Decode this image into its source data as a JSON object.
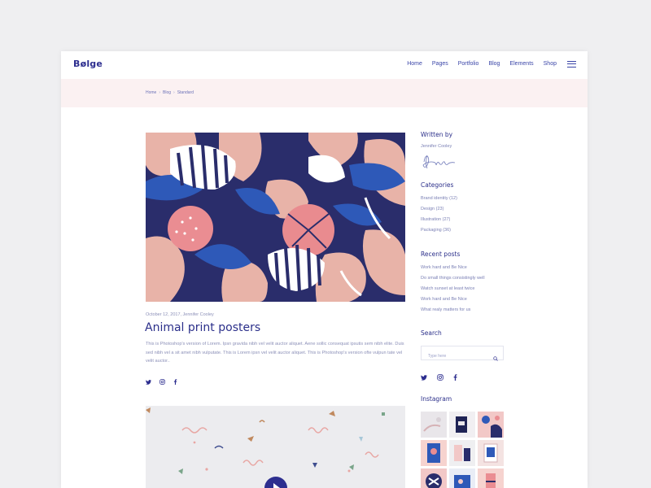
{
  "header": {
    "logo": "Bølge",
    "nav": [
      "Home",
      "Pages",
      "Portfolio",
      "Blog",
      "Elements",
      "Shop"
    ]
  },
  "breadcrumb": [
    "Home",
    "Blog",
    "Standard"
  ],
  "post": {
    "meta": "October 12, 2017, Jennifer Cooley",
    "title": "Animal print posters",
    "body": "This is Photoshop's version of Lorem. Ipsn gravida nibh vel velit auctor aliquet. Aene sollic consequat ipsutis sem nibh elite. Duis sed nibh vel a sit amet nibh vulputate. This is Lorem ipsn vel velit auctor aliquet. This is Photoshop's version ofte vulpun tate vel velit auctor..",
    "share_icons": [
      "twitter-icon",
      "instagram-icon",
      "facebook-icon"
    ]
  },
  "sidebar": {
    "written_by": {
      "heading": "Written by",
      "author": "Jennifer Cooley"
    },
    "categories": {
      "heading": "Categories",
      "items": [
        {
          "name": "Brand identity",
          "count": "(12)"
        },
        {
          "name": "Design",
          "count": "(23)"
        },
        {
          "name": "Illustration",
          "count": "(27)"
        },
        {
          "name": "Packaging",
          "count": "(36)"
        }
      ]
    },
    "recent_posts": {
      "heading": "Recent posts",
      "items": [
        "Work hard and Be Nice",
        "Do small things consistingly well",
        "Watch sunset at least twice",
        "Work hard and Be Nice",
        "What realy matters for us"
      ]
    },
    "search": {
      "heading": "Search",
      "placeholder": "Type here"
    },
    "social_icons": [
      "twitter-icon",
      "instagram-icon",
      "facebook-icon"
    ],
    "instagram": {
      "heading": "Instagram"
    }
  },
  "colors": {
    "brand": "#2b2f8a",
    "accent_pink": "#f0a7a6",
    "crumb_band": "#fbf1f2",
    "hero_navy": "#2a2d6b",
    "hero_blue": "#2e59b8"
  }
}
